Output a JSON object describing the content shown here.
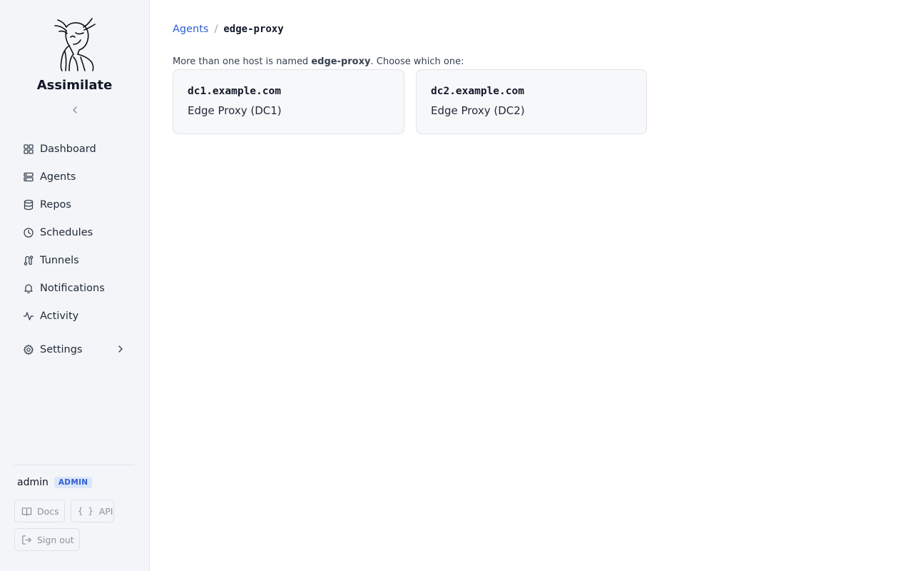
{
  "app": {
    "name": "Assimilate"
  },
  "sidebar": {
    "items": [
      {
        "label": "Dashboard",
        "icon": "dashboard-icon"
      },
      {
        "label": "Agents",
        "icon": "server-icon"
      },
      {
        "label": "Repos",
        "icon": "database-icon"
      },
      {
        "label": "Schedules",
        "icon": "clock-icon"
      },
      {
        "label": "Tunnels",
        "icon": "route-icon"
      },
      {
        "label": "Notifications",
        "icon": "bell-icon"
      },
      {
        "label": "Activity",
        "icon": "activity-icon"
      }
    ],
    "settings": {
      "label": "Settings",
      "icon": "gear-icon"
    },
    "user": {
      "name": "admin",
      "role": "ADMIN"
    },
    "footer": {
      "docs": "Docs",
      "api": "API",
      "api_glyph": "{ }",
      "signout": "Sign out"
    }
  },
  "breadcrumb": {
    "parent": "Agents",
    "separator": "/",
    "current": "edge-proxy"
  },
  "prompt": {
    "before": "More than one host is named ",
    "name": "edge-proxy",
    "after": ". Choose which one:"
  },
  "hosts": [
    {
      "fqdn": "dc1.example.com",
      "label": "Edge Proxy (DC1)"
    },
    {
      "fqdn": "dc2.example.com",
      "label": "Edge Proxy (DC2)"
    }
  ],
  "colors": {
    "accent": "#2f5fd6",
    "sidebar_bg": "#f3f5f8",
    "card_bg": "#f7f8fa",
    "badge_bg": "#dbe6fb"
  }
}
